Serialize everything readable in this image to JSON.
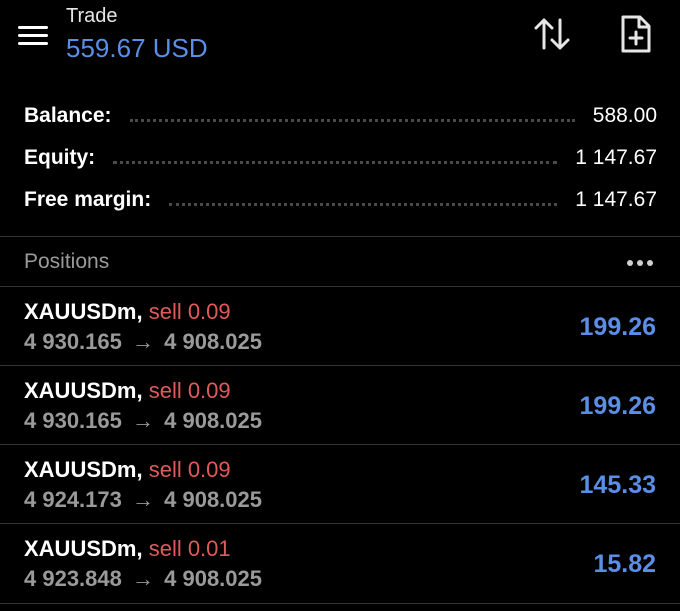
{
  "header": {
    "title": "Trade",
    "subtitle": "559.67 USD",
    "icons": {
      "menu": "hamburger-menu-icon",
      "sort": "sort-arrows-icon",
      "new_order": "new-document-plus-icon"
    }
  },
  "summary": [
    {
      "label": "Balance:",
      "value": "588.00"
    },
    {
      "label": "Equity:",
      "value": "1 147.67"
    },
    {
      "label": "Free margin:",
      "value": "1 147.67"
    }
  ],
  "positions": {
    "title": "Positions",
    "items": [
      {
        "symbol": "XAUUSDm,",
        "side": "sell 0.09",
        "open_price": "4 930.165",
        "arrow": "→",
        "current_price": "4 908.025",
        "profit": "199.26"
      },
      {
        "symbol": "XAUUSDm,",
        "side": "sell 0.09",
        "open_price": "4 930.165",
        "arrow": "→",
        "current_price": "4 908.025",
        "profit": "199.26"
      },
      {
        "symbol": "XAUUSDm,",
        "side": "sell 0.09",
        "open_price": "4 924.173",
        "arrow": "→",
        "current_price": "4 908.025",
        "profit": "145.33"
      },
      {
        "symbol": "XAUUSDm,",
        "side": "sell 0.01",
        "open_price": "4 923.848",
        "arrow": "→",
        "current_price": "4 908.025",
        "profit": "15.82"
      }
    ]
  },
  "colors": {
    "background": "#000000",
    "accent": "#5b8ee6",
    "sell": "#e05a5a",
    "muted": "#9a9a9a",
    "divider": "#333333"
  }
}
